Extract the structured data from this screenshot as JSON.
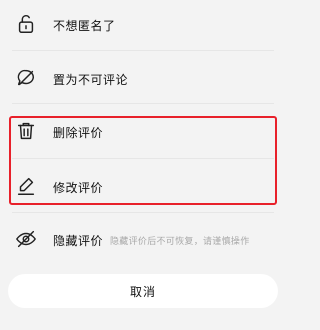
{
  "menu": {
    "items": [
      {
        "label": "不想匿名了",
        "icon": "unlock-icon"
      },
      {
        "label": "置为不可评论",
        "icon": "no-comment-icon"
      },
      {
        "label": "删除评价",
        "icon": "trash-icon"
      },
      {
        "label": "修改评价",
        "icon": "edit-icon"
      },
      {
        "label": "隐藏评价",
        "icon": "eye-hidden-icon",
        "hint": "隐藏评价后不可恢复，请谨慎操作"
      }
    ]
  },
  "cancel_label": "取消",
  "colors": {
    "highlight": "#e8202a",
    "background": "#f3f3f3",
    "hint": "#a8a8a8"
  }
}
